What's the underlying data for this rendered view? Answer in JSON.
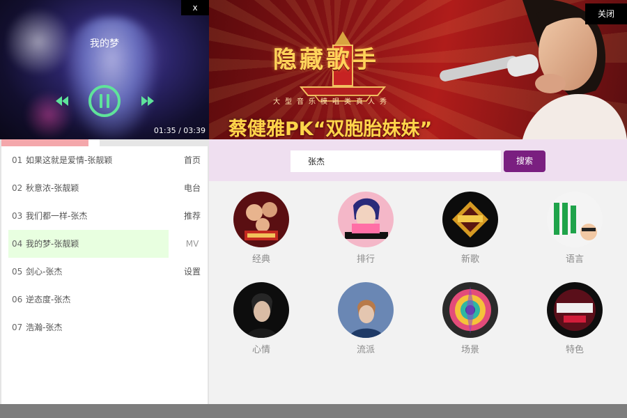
{
  "player": {
    "close_label": "x",
    "song_title": "我的梦",
    "time": "01:35 / 03:39",
    "progress": 0.43
  },
  "banner": {
    "close_label": "关闭",
    "show_title": "隐藏歌手",
    "show_subtitle": "大型音乐模唱类真人秀",
    "headline": "蔡健雅PK“双胞胎妹妹”"
  },
  "playlist": [
    {
      "num": "01",
      "title": "如果这就是爱情-张靓颖"
    },
    {
      "num": "02",
      "title": "秋意浓-张靓颖"
    },
    {
      "num": "03",
      "title": "我们都一样-张杰"
    },
    {
      "num": "04",
      "title": "我的梦-张靓颖"
    },
    {
      "num": "05",
      "title": "剑心-张杰"
    },
    {
      "num": "06",
      "title": "逆态度-张杰"
    },
    {
      "num": "07",
      "title": "浩瀚-张杰"
    }
  ],
  "active_index": 3,
  "side_nav": [
    "首页",
    "电台",
    "推荐",
    "MV",
    "设置"
  ],
  "search": {
    "value": "张杰",
    "button_label": "搜索"
  },
  "categories": [
    {
      "label": "经典"
    },
    {
      "label": "排行"
    },
    {
      "label": "新歌"
    },
    {
      "label": "语言"
    },
    {
      "label": "心情"
    },
    {
      "label": "流派"
    },
    {
      "label": "场景"
    },
    {
      "label": "特色"
    }
  ],
  "colors": {
    "accent": "#7a1f80",
    "search_bg": "#efdff0",
    "active_row": "#e8ffe0",
    "controls": "#5fe39a",
    "progress": "#f4a7ab"
  }
}
